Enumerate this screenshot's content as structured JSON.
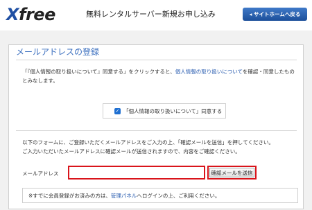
{
  "header": {
    "logo_x": "X",
    "logo_rest": "free",
    "title": "無料レンタルサーバー新規お申し込み",
    "home_button": "◂ サイトホームへ戻る"
  },
  "card": {
    "title": "メールアドレスの登録",
    "privacy_text_1": "「『個人情報の取り扱いについて』同意する」をクリックすると、",
    "privacy_link": "個人情報の取り扱いについて",
    "privacy_text_2": "を確認・同意したものとみなします。",
    "agree_checkbox": "✓",
    "agree_label": "「個人情報の取り扱いについて」同意する",
    "instruction_line1": "以下のフォームに、ご登録いただくメールアドレスをご入力の上、「確認メールを送信」を押してください。",
    "instruction_line2": "ご入力いただいたメールアドレスに確認メールが送信されますので、内容をご確認ください。",
    "email_label": "メールアドレス",
    "email_value": "",
    "send_button": "確認メールを送信",
    "note_prefix": "※すでに会員登録がお済みの方は、",
    "note_link": "管理パネル",
    "note_suffix": "へログインの上、ご利用ください。"
  },
  "colors": {
    "brand_blue": "#1f4fa3",
    "link_blue": "#2a5db0",
    "highlight_red": "#d9141b"
  }
}
